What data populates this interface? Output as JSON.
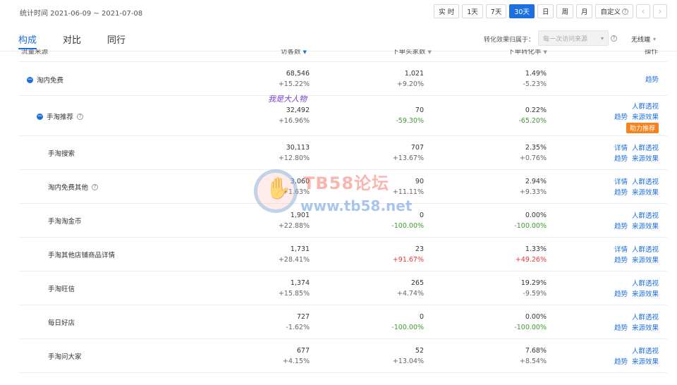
{
  "header": {
    "stat_time": "统计时间 2021-06-09 ~ 2021-07-08",
    "ranges": [
      "实 时",
      "1天",
      "7天",
      "30天",
      "日",
      "周",
      "月"
    ],
    "active_range": "30天",
    "custom_label": "自定义",
    "prev_arrow": "‹",
    "next_arrow": "›"
  },
  "tabs": [
    "构成",
    "对比",
    "同行"
  ],
  "active_tab": "构成",
  "attribution": {
    "label": "转化效果归属于：",
    "select_value": "每一次访问来源",
    "wireless_label": "无线端"
  },
  "columns": {
    "source": "流量来源",
    "visitors": "访客数",
    "buyers": "下单买家数",
    "conversion": "下单转化率",
    "ops": "操作"
  },
  "links": {
    "detail": "详情",
    "crowd": "人群透视",
    "trend": "趋势",
    "source_effect": "来源效果",
    "boost": "助力推荐"
  },
  "rows": [
    {
      "name": "淘内免费",
      "visitors": "68,546",
      "visitors_change": "+15.22%",
      "buyers": "1,021",
      "buyers_change": "+9.20%",
      "conv": "1.49%",
      "conv_change": "-5.23%"
    },
    {
      "name": "手淘推荐",
      "visitors": "32,492",
      "visitors_change": "+16.96%",
      "buyers": "70",
      "buyers_change": "-59.30%",
      "conv": "0.22%",
      "conv_change": "-65.20%"
    },
    {
      "name": "手淘搜索",
      "visitors": "30,113",
      "visitors_change": "+12.80%",
      "buyers": "707",
      "buyers_change": "+13.67%",
      "conv": "2.35%",
      "conv_change": "+0.76%"
    },
    {
      "name": "淘内免费其他",
      "visitors": "3,060",
      "visitors_change": "+1.63%",
      "buyers": "90",
      "buyers_change": "+11.11%",
      "conv": "2.94%",
      "conv_change": "+9.33%"
    },
    {
      "name": "手淘淘金币",
      "visitors": "1,901",
      "visitors_change": "+22.88%",
      "buyers": "0",
      "buyers_change": "-100.00%",
      "conv": "0.00%",
      "conv_change": "-100.00%"
    },
    {
      "name": "手淘其他店铺商品详情",
      "visitors": "1,731",
      "visitors_change": "+28.41%",
      "buyers": "23",
      "buyers_change": "+91.67%",
      "conv": "1.33%",
      "conv_change": "+49.26%"
    },
    {
      "name": "手淘旺信",
      "visitors": "1,374",
      "visitors_change": "+15.85%",
      "buyers": "265",
      "buyers_change": "+4.74%",
      "conv": "19.29%",
      "conv_change": "-9.59%"
    },
    {
      "name": "每日好店",
      "visitors": "727",
      "visitors_change": "-1.62%",
      "buyers": "0",
      "buyers_change": "-100.00%",
      "conv": "0.00%",
      "conv_change": "-100.00%"
    },
    {
      "name": "手淘问大家",
      "visitors": "677",
      "visitors_change": "+4.15%",
      "buyers": "52",
      "buyers_change": "+13.04%",
      "conv": "7.68%",
      "conv_change": "+8.54%"
    }
  ],
  "handwriting": "我是大人物",
  "watermark": {
    "title": "TB58论坛",
    "url": "www.tb58.net"
  },
  "colors": {
    "accent": "#1d6fe0",
    "up": "#e8393a",
    "down": "#3d9b2e",
    "boost": "#f5841f"
  }
}
